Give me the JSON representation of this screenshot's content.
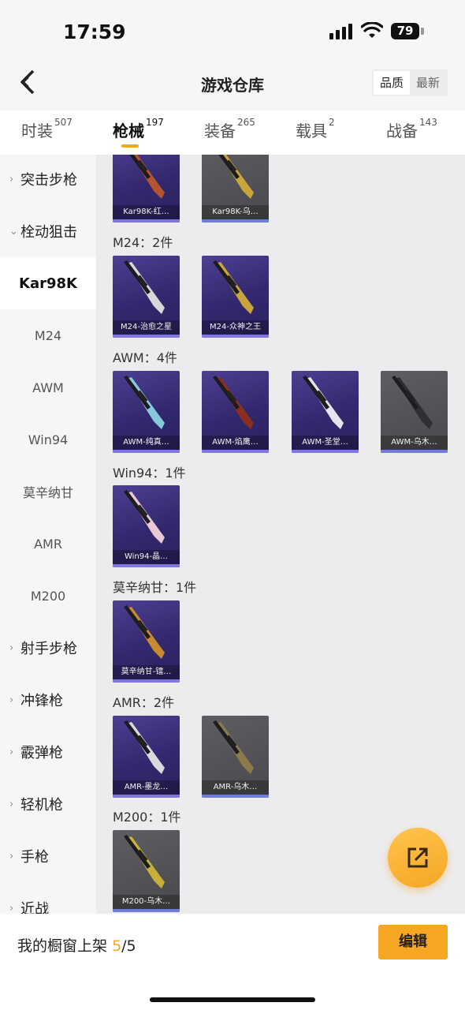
{
  "status_bar": {
    "time": "17:59",
    "battery": "79"
  },
  "nav": {
    "title": "游戏仓库",
    "sort_options": [
      "品质",
      "最新"
    ],
    "sort_selected": "品质"
  },
  "tabs": [
    {
      "label": "时装",
      "count": "507"
    },
    {
      "label": "枪械",
      "count": "197",
      "active": true
    },
    {
      "label": "装备",
      "count": "265"
    },
    {
      "label": "载具",
      "count": "2"
    },
    {
      "label": "战备",
      "count": "143"
    }
  ],
  "sidebar": [
    {
      "label": "突击步枪",
      "type": "group",
      "expanded": false
    },
    {
      "label": "栓动狙击",
      "type": "group",
      "expanded": true
    },
    {
      "label": "Kar98K",
      "type": "sub",
      "selected": true
    },
    {
      "label": "M24",
      "type": "sub"
    },
    {
      "label": "AWM",
      "type": "sub"
    },
    {
      "label": "Win94",
      "type": "sub"
    },
    {
      "label": "莫辛纳甘",
      "type": "sub"
    },
    {
      "label": "AMR",
      "type": "sub"
    },
    {
      "label": "M200",
      "type": "sub"
    },
    {
      "label": "射手步枪",
      "type": "group",
      "expanded": false
    },
    {
      "label": "冲锋枪",
      "type": "group",
      "expanded": false
    },
    {
      "label": "霰弹枪",
      "type": "group",
      "expanded": false
    },
    {
      "label": "轻机枪",
      "type": "group",
      "expanded": false
    },
    {
      "label": "手枪",
      "type": "group",
      "expanded": false
    },
    {
      "label": "近战",
      "type": "group",
      "expanded": false
    }
  ],
  "sections": [
    {
      "title": "",
      "items": [
        {
          "name": "Kar98K-红…",
          "quality": "purple",
          "accent": "#b5552f"
        },
        {
          "name": "Kar98K-乌…",
          "quality": "gray",
          "accent": "#c9a53a"
        }
      ]
    },
    {
      "title": "M24：2件",
      "items": [
        {
          "name": "M24-治愈之星",
          "quality": "purple",
          "accent": "#d7d7dc"
        },
        {
          "name": "M24-众神之王",
          "quality": "purple",
          "accent": "#c9a53a"
        }
      ]
    },
    {
      "title": "AWM：4件",
      "items": [
        {
          "name": "AWM-纯真…",
          "quality": "purple",
          "accent": "#86c9dd"
        },
        {
          "name": "AWM-焰鹰…",
          "quality": "purple",
          "accent": "#8a2e22"
        },
        {
          "name": "AWM-圣堂…",
          "quality": "purple",
          "accent": "#e5e5ee"
        },
        {
          "name": "AWM-乌木…",
          "quality": "gray",
          "accent": "#2e2e33"
        }
      ]
    },
    {
      "title": "Win94：1件",
      "items": [
        {
          "name": "Win94-晶…",
          "quality": "purple",
          "accent": "#e9c9d6"
        }
      ]
    },
    {
      "title": "莫辛纳甘：1件",
      "items": [
        {
          "name": "莫辛纳甘-镭…",
          "quality": "purple",
          "accent": "#c98a2f"
        }
      ]
    },
    {
      "title": "AMR：2件",
      "items": [
        {
          "name": "AMR-墨龙…",
          "quality": "purple",
          "accent": "#d9d9de"
        },
        {
          "name": "AMR-乌木…",
          "quality": "gray",
          "accent": "#8d7a4a"
        }
      ]
    },
    {
      "title": "M200：1件",
      "items": [
        {
          "name": "M200-乌木…",
          "quality": "gray",
          "accent": "#c7b03a"
        }
      ]
    }
  ],
  "bottom_bar": {
    "showcase_label": "我的橱窗上架",
    "showcase_used": "5",
    "showcase_total": "/5",
    "edit_label": "编辑"
  }
}
